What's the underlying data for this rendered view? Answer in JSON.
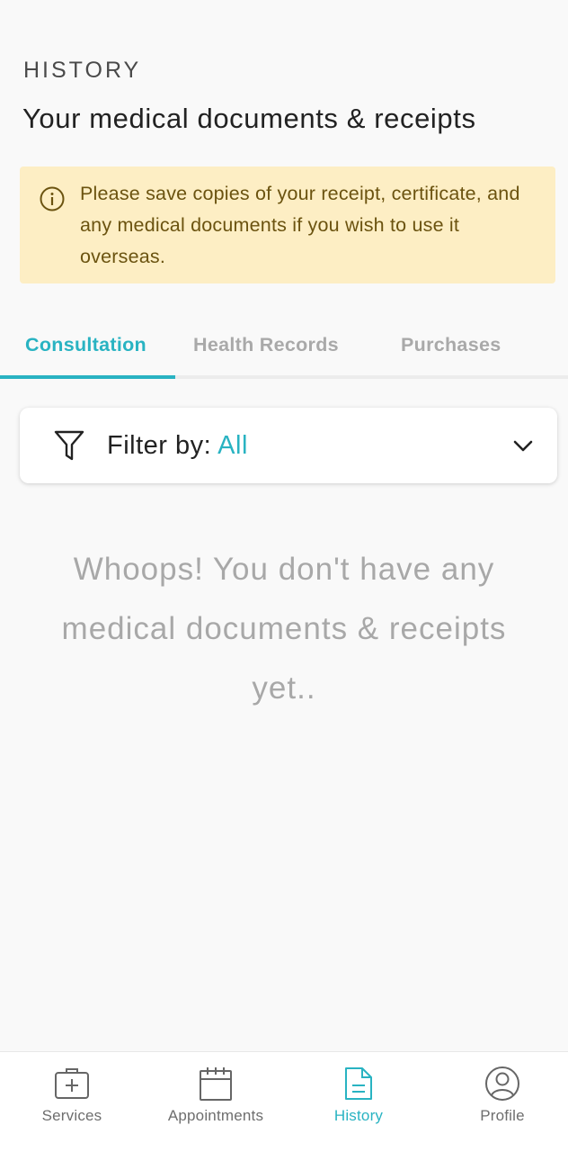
{
  "header": {
    "eyebrow": "HISTORY",
    "title": "Your medical documents & receipts"
  },
  "notice": {
    "icon": "info-icon",
    "text": "Please save copies of your receipt, certificate, and any medical documents if you wish to use it overseas."
  },
  "tabs": [
    {
      "label": "Consultation",
      "active": true
    },
    {
      "label": "Health Records",
      "active": false
    },
    {
      "label": "Purchases",
      "active": false
    }
  ],
  "filter": {
    "label": "Filter by:",
    "value": "All",
    "icon": "filter-icon"
  },
  "empty_state": {
    "message": "Whoops! You don't have any medical documents & receipts yet.."
  },
  "bottom_nav": [
    {
      "label": "Services",
      "icon": "medical-bag-icon",
      "active": false
    },
    {
      "label": "Appointments",
      "icon": "calendar-icon",
      "active": false
    },
    {
      "label": "History",
      "icon": "document-icon",
      "active": true
    },
    {
      "label": "Profile",
      "icon": "user-circle-icon",
      "active": false
    }
  ],
  "colors": {
    "accent": "#29b3c2",
    "notice_background": "#fdeec4",
    "notice_text": "#6b5310",
    "muted_text": "#a8a8a8"
  }
}
